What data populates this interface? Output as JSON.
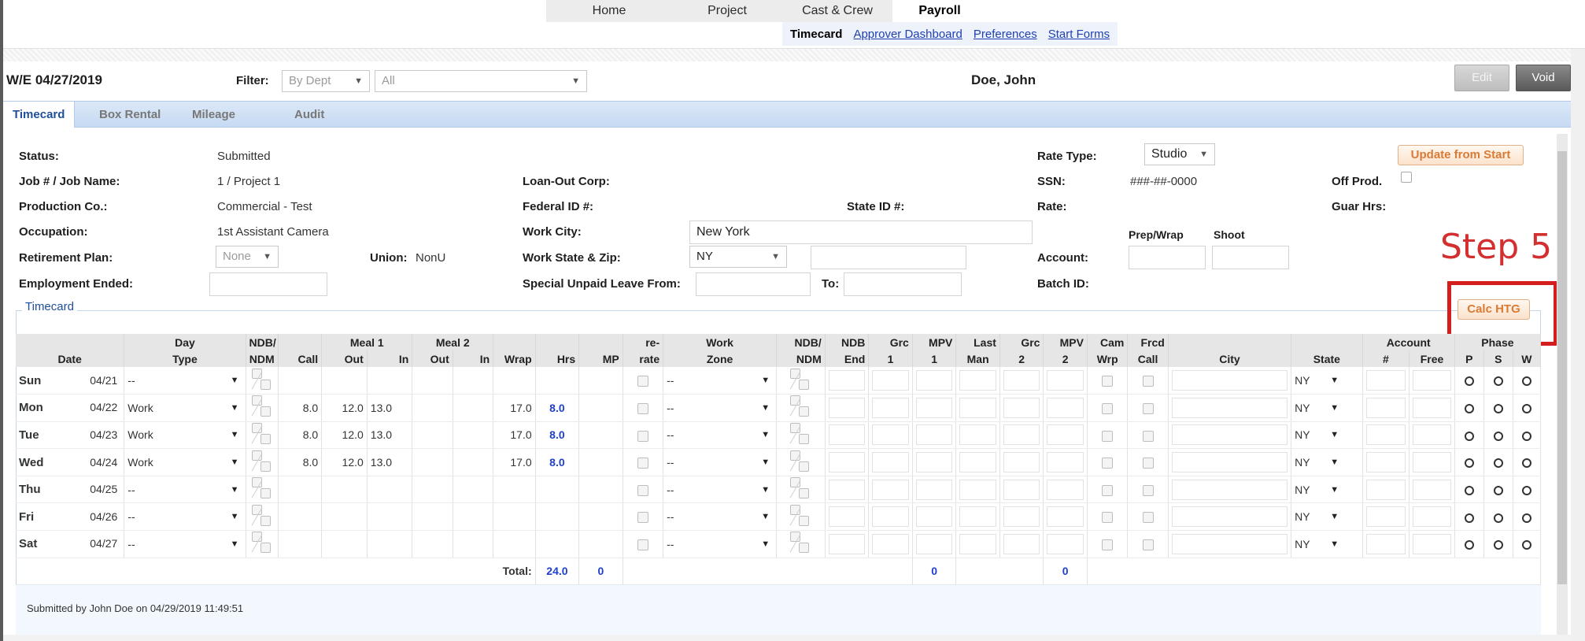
{
  "nav": {
    "tabs": [
      "Home",
      "Project",
      "Cast & Crew",
      "Payroll"
    ],
    "active_tab": "Payroll",
    "subnav": {
      "current": "Timecard",
      "links": [
        "Approver Dashboard",
        "Preferences",
        "Start Forms"
      ]
    }
  },
  "header": {
    "week_ending": "W/E  04/27/2019",
    "filter_label": "Filter:",
    "filter_dept": "By Dept",
    "filter_value": "All",
    "employee_name": "Doe, John",
    "edit_label": "Edit",
    "void_label": "Void"
  },
  "tabs": [
    "Timecard",
    "Box Rental",
    "Mileage",
    "Audit"
  ],
  "info": {
    "status_label": "Status:",
    "status_value": "Submitted",
    "job_label": "Job # / Job Name:",
    "job_value": "1 / Project 1",
    "prodco_label": "Production Co.:",
    "prodco_value": "Commercial - Test",
    "occupation_label": "Occupation:",
    "occupation_value": "1st Assistant Camera",
    "retirement_label": "Retirement Plan:",
    "retirement_value": "None",
    "union_label": "Union:",
    "union_value": "NonU",
    "employment_ended_label": "Employment Ended:",
    "loanout_label": "Loan-Out Corp:",
    "federal_label": "Federal ID #:",
    "stateid_label": "State ID #:",
    "workcity_label": "Work City:",
    "workcity_value": "New York",
    "workstate_label": "Work State & Zip:",
    "workstate_value": "NY",
    "unpaid_label": "Special Unpaid Leave From:",
    "to_label": "To:",
    "ratetype_label": "Rate Type:",
    "ratetype_value": "Studio",
    "update_btn": "Update from Start",
    "ssn_label": "SSN:",
    "ssn_value": "###-##-0000",
    "offprod_label": "Off Prod.",
    "rate_label": "Rate:",
    "guar_label": "Guar Hrs:",
    "prepwrap_label": "Prep/Wrap",
    "shoot_label": "Shoot",
    "account_label": "Account:",
    "batch_label": "Batch ID:",
    "calc_btn": "Calc HTG",
    "step_annotation": "Step 5"
  },
  "timecard": {
    "legend": "Timecard",
    "header_top": [
      "",
      "Day",
      "NDB/",
      "",
      "Meal 1",
      "",
      "Meal 2",
      "",
      "",
      "",
      "",
      "re-",
      "Work",
      "NDB/",
      "NDB",
      "Grc",
      "MPV",
      "Last",
      "Grc",
      "MPV",
      "Cam",
      "Frcd",
      "",
      "",
      "Account",
      "",
      "Phase",
      "",
      ""
    ],
    "header_bottom": [
      "Date",
      "Type",
      "NDM",
      "Call",
      "Out",
      "In",
      "Out",
      "In",
      "Wrap",
      "Hrs",
      "MP",
      "rate",
      "Zone",
      "NDM",
      "End",
      "1",
      "1",
      "Man",
      "2",
      "2",
      "Wrp",
      "Call",
      "City",
      "State",
      "#",
      "Free",
      "P",
      "S",
      "W"
    ],
    "rows": [
      {
        "day": "Sun",
        "date": "04/21",
        "type": "--",
        "call": "",
        "out1": "",
        "in1": "",
        "wrap": "",
        "hrs": "",
        "zone": "--",
        "state": "NY"
      },
      {
        "day": "Mon",
        "date": "04/22",
        "type": "Work",
        "call": "8.0",
        "out1": "12.0",
        "in1": "13.0",
        "wrap": "17.0",
        "hrs": "8.0",
        "zone": "--",
        "state": "NY"
      },
      {
        "day": "Tue",
        "date": "04/23",
        "type": "Work",
        "call": "8.0",
        "out1": "12.0",
        "in1": "13.0",
        "wrap": "17.0",
        "hrs": "8.0",
        "zone": "--",
        "state": "NY"
      },
      {
        "day": "Wed",
        "date": "04/24",
        "type": "Work",
        "call": "8.0",
        "out1": "12.0",
        "in1": "13.0",
        "wrap": "17.0",
        "hrs": "8.0",
        "zone": "--",
        "state": "NY"
      },
      {
        "day": "Thu",
        "date": "04/25",
        "type": "--",
        "call": "",
        "out1": "",
        "in1": "",
        "wrap": "",
        "hrs": "",
        "zone": "--",
        "state": "NY"
      },
      {
        "day": "Fri",
        "date": "04/26",
        "type": "--",
        "call": "",
        "out1": "",
        "in1": "",
        "wrap": "",
        "hrs": "",
        "zone": "--",
        "state": "NY"
      },
      {
        "day": "Sat",
        "date": "04/27",
        "type": "--",
        "call": "",
        "out1": "",
        "in1": "",
        "wrap": "",
        "hrs": "",
        "zone": "--",
        "state": "NY"
      }
    ],
    "totals": {
      "label": "Total:",
      "hrs": "24.0",
      "mp": "0",
      "mpv1": "0",
      "mpv2": "0"
    },
    "submitted_text": "Submitted by John Doe on 04/29/2019 11:49:51"
  },
  "colors": {
    "link": "#1f3fb0",
    "accent_orange": "#d97b36",
    "annotation_red": "#d42f2f",
    "hours_blue": "#1f3fcf"
  }
}
